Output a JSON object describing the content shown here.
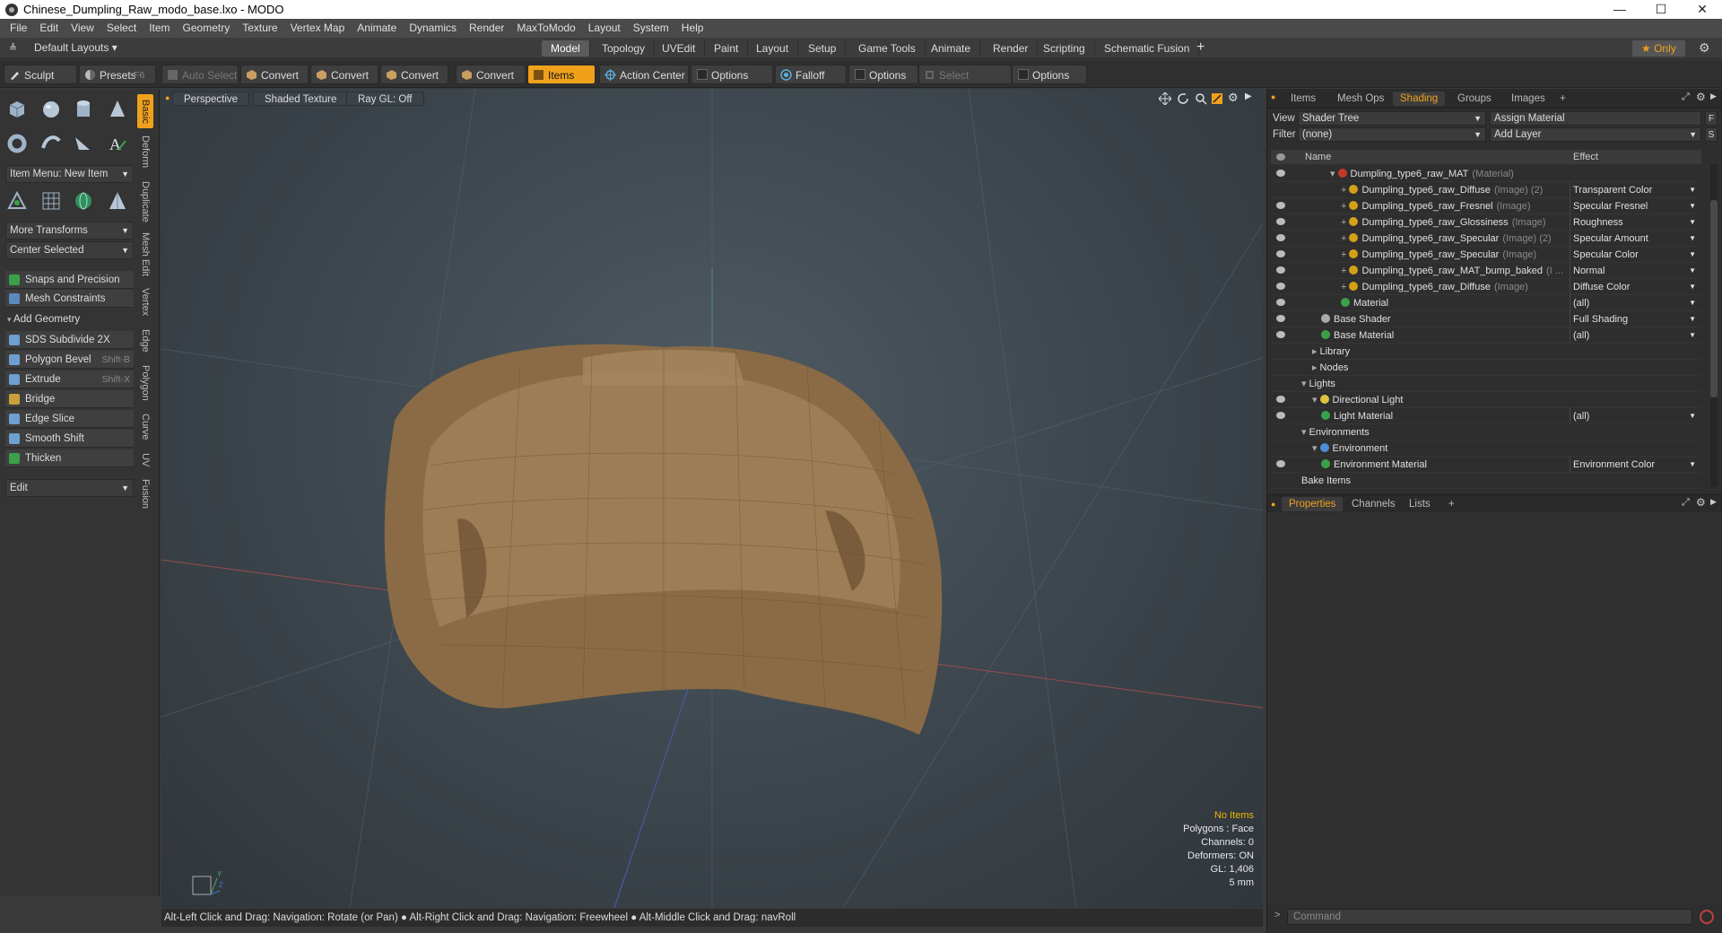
{
  "window": {
    "title": "Chinese_Dumpling_Raw_modo_base.lxo - MODO",
    "minimize": "—",
    "maximize": "☐",
    "close": "✕"
  },
  "menu": [
    "File",
    "Edit",
    "View",
    "Select",
    "Item",
    "Geometry",
    "Texture",
    "Vertex Map",
    "Animate",
    "Dynamics",
    "Render",
    "MaxToModo",
    "Layout",
    "System",
    "Help"
  ],
  "layout": {
    "default_layouts": "Default Layouts ▾",
    "tabs": [
      "Model",
      "Topology",
      "UVEdit",
      "Paint",
      "Layout",
      "Setup",
      "Game Tools",
      "Animate",
      "Render",
      "Scripting",
      "Schematic Fusion"
    ],
    "active_tab": "Model",
    "add": "+",
    "only": "★ Only",
    "gear": "⚙"
  },
  "toolbar": {
    "sculpt": "Sculpt",
    "presets": "Presets",
    "presets_key": "F6",
    "auto_select": "Auto Select",
    "convert": "Convert",
    "items": "Items",
    "action_center": "Action Center",
    "options": "Options",
    "falloff": "Falloff",
    "select_through": "Select Through"
  },
  "left": {
    "item_menu": "Item Menu: New Item",
    "more_transforms": "More Transforms",
    "center_selected": "Center Selected",
    "snaps": "Snaps and Precision",
    "mesh_constraints": "Mesh Constraints",
    "add_geometry": "Add Geometry",
    "tools": [
      {
        "label": "SDS Subdivide 2X",
        "shortcut": ""
      },
      {
        "label": "Polygon Bevel",
        "shortcut": "Shift-B"
      },
      {
        "label": "Extrude",
        "shortcut": "Shift-X"
      },
      {
        "label": "Bridge",
        "shortcut": ""
      },
      {
        "label": "Edge Slice",
        "shortcut": ""
      },
      {
        "label": "Smooth Shift",
        "shortcut": ""
      },
      {
        "label": "Thicken",
        "shortcut": ""
      }
    ],
    "edit": "Edit",
    "vtabs": [
      "Basic",
      "Deform",
      "Duplicate",
      "Mesh Edit",
      "Vertex",
      "Edge",
      "Polygon",
      "Curve",
      "UV",
      "Fusion"
    ]
  },
  "viewport": {
    "perspective": "Perspective",
    "shaded": "Shaded Texture",
    "raygl": "Ray GL: Off",
    "info": {
      "no_items": "No Items",
      "polygons": "Polygons : Face",
      "channels": "Channels: 0",
      "deformers": "Deformers: ON",
      "gl": "GL: 1,406",
      "scale": "5 mm"
    }
  },
  "status": "Alt-Left Click and Drag: Navigation: Rotate (or Pan) ● Alt-Right Click and Drag: Navigation: Freewheel ● Alt-Middle Click and Drag: navRoll",
  "right": {
    "tabs": [
      "Items",
      "Mesh Ops",
      "Shading",
      "Groups",
      "Images",
      "+"
    ],
    "active_tab": "Shading",
    "view_label": "View",
    "view_value": "Shader Tree",
    "assign": "Assign Material",
    "filter_label": "Filter",
    "filter_value": "(none)",
    "add_layer": "Add Layer",
    "f_btn": "F",
    "s_btn": "S",
    "col_name": "Name",
    "col_effect": "Effect",
    "tree": [
      {
        "name": "Dumpling_type6_raw_MAT",
        "type": "(Material)",
        "effect": "",
        "indent": 0,
        "color": "#c0392b",
        "eye": true,
        "exp": "▾"
      },
      {
        "name": "Dumpling_type6_raw_Diffuse",
        "type": "(Image) (2)",
        "effect": "Transparent Color",
        "indent": 1,
        "color": "#d4a017",
        "eye": false,
        "exp": "+"
      },
      {
        "name": "Dumpling_type6_raw_Fresnel",
        "type": "(Image)",
        "effect": "Specular Fresnel",
        "indent": 1,
        "color": "#d4a017",
        "eye": true,
        "exp": "+"
      },
      {
        "name": "Dumpling_type6_raw_Glossiness",
        "type": "(Image)",
        "effect": "Roughness",
        "indent": 1,
        "color": "#d4a017",
        "eye": true,
        "exp": "+"
      },
      {
        "name": "Dumpling_type6_raw_Specular",
        "type": "(Image) (2)",
        "effect": "Specular Amount",
        "indent": 1,
        "color": "#d4a017",
        "eye": true,
        "exp": "+"
      },
      {
        "name": "Dumpling_type6_raw_Specular",
        "type": "(Image)",
        "effect": "Specular Color",
        "indent": 1,
        "color": "#d4a017",
        "eye": true,
        "exp": "+"
      },
      {
        "name": "Dumpling_type6_raw_MAT_bump_baked",
        "type": "(I ...",
        "effect": "Normal",
        "indent": 1,
        "color": "#d4a017",
        "eye": true,
        "exp": "+"
      },
      {
        "name": "Dumpling_type6_raw_Diffuse",
        "type": "(Image)",
        "effect": "Diffuse Color",
        "indent": 1,
        "color": "#d4a017",
        "eye": true,
        "exp": "+"
      },
      {
        "name": "Material",
        "type": "",
        "effect": "(all)",
        "indent": 1,
        "color": "#3aa14a",
        "eye": true,
        "exp": ""
      },
      {
        "name": "Base Shader",
        "type": "",
        "effect": "Full Shading",
        "indent": -1,
        "color": "#aaaaaa",
        "eye": true,
        "exp": ""
      },
      {
        "name": "Base Material",
        "type": "",
        "effect": "(all)",
        "indent": -1,
        "color": "#3aa14a",
        "eye": true,
        "exp": ""
      },
      {
        "name": "Library",
        "type": "",
        "effect": "",
        "indent": -2,
        "color": "",
        "eye": false,
        "exp": "▸"
      },
      {
        "name": "Nodes",
        "type": "",
        "effect": "",
        "indent": -2,
        "color": "",
        "eye": false,
        "exp": "▸"
      },
      {
        "name": "Lights",
        "type": "",
        "effect": "",
        "indent": -3,
        "color": "",
        "eye": false,
        "exp": "▾"
      },
      {
        "name": "Directional Light",
        "type": "",
        "effect": "",
        "indent": -2,
        "color": "#e0c040",
        "eye": true,
        "exp": "▾"
      },
      {
        "name": "Light Material",
        "type": "",
        "effect": "(all)",
        "indent": -1,
        "color": "#3aa14a",
        "eye": true,
        "exp": ""
      },
      {
        "name": "Environments",
        "type": "",
        "effect": "",
        "indent": -3,
        "color": "",
        "eye": false,
        "exp": "▾"
      },
      {
        "name": "Environment",
        "type": "",
        "effect": "",
        "indent": -2,
        "color": "#4a8fd4",
        "eye": false,
        "exp": "▾"
      },
      {
        "name": "Environment Material",
        "type": "",
        "effect": "Environment Color",
        "indent": -1,
        "color": "#3aa14a",
        "eye": true,
        "exp": ""
      },
      {
        "name": "Bake Items",
        "type": "",
        "effect": "",
        "indent": -3,
        "color": "",
        "eye": false,
        "exp": ""
      }
    ],
    "bottom_tabs": [
      "Properties",
      "Channels",
      "Lists",
      "+"
    ],
    "bottom_active": "Properties",
    "command": "Command"
  }
}
